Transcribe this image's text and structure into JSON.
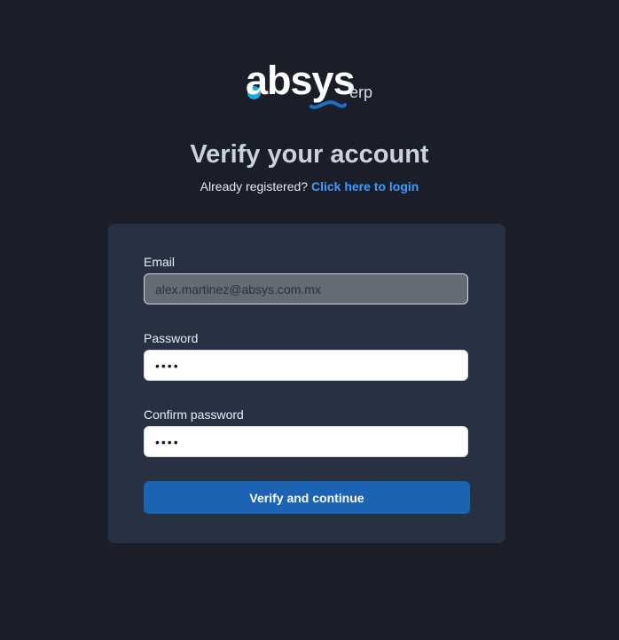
{
  "branding": {
    "logo_text": "absys",
    "logo_suffix": "erp"
  },
  "header": {
    "title": "Verify your account",
    "registered_text": "Already registered?",
    "login_link": "Click here to login"
  },
  "form": {
    "email": {
      "label": "Email",
      "value": "alex.martinez@absys.com.mx"
    },
    "password": {
      "label": "Password",
      "value": "••••"
    },
    "confirm_password": {
      "label": "Confirm password",
      "value": "••••"
    },
    "submit_label": "Verify and continue"
  },
  "colors": {
    "background": "#1b1e28",
    "card": "#273141",
    "accent": "#1d63b3",
    "link": "#3b9dff"
  },
  "icons": {
    "logo": "absys-logo",
    "logo_swoosh": "wave-swoosh"
  }
}
